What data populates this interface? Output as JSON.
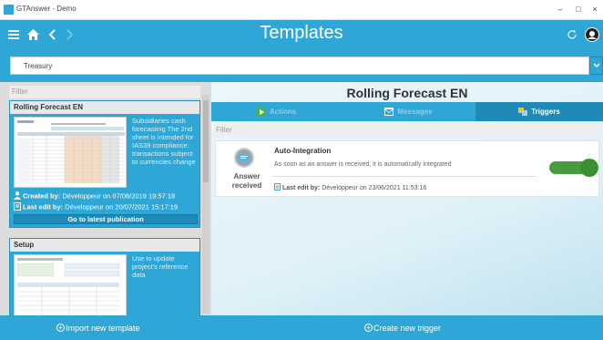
{
  "window": {
    "title": "GTAnswer - Demo",
    "minimize": "–",
    "maximize": "□",
    "close": "×"
  },
  "header": {
    "title": "Templates"
  },
  "selector": {
    "value": "Treasury"
  },
  "left": {
    "filter_placeholder": "Filter",
    "templates": [
      {
        "name": "Rolling Forecast EN",
        "description": "Subsidiaries cash forecasting The 2nd sheet is intended for IAS39 compliance: transactions subject to currencies change",
        "created_label": "Created by:",
        "created_value": "Développeur on 07/06/2019 19:57:18",
        "edit_label": "Last edit by:",
        "edit_value": "Développeur on 20/07/2021 15:17:19",
        "action": "Go to latest publication"
      },
      {
        "name": "Setup",
        "description": "Use to update project's reference data"
      }
    ]
  },
  "detail": {
    "title": "Rolling Forecast EN",
    "tabs": [
      {
        "label": "Actions",
        "icon": "play-icon"
      },
      {
        "label": "Messages",
        "icon": "message-icon"
      },
      {
        "label": "Triggers",
        "icon": "triggers-icon"
      }
    ],
    "filter_placeholder": "Filter",
    "trigger": {
      "event": "Answer received",
      "name": "Auto-Integration",
      "description": "As soon as an answer is received, it is automatically integrated",
      "edit_label": "Last edit by:",
      "edit_value": "Développeur on 23/06/2021 11:53:16",
      "enabled": true
    }
  },
  "footer": {
    "import": "Import new template",
    "create": "Create new trigger"
  },
  "colors": {
    "accent": "#2ea6d6",
    "accent_dark": "#1f8ab7",
    "toggle_on": "#4a9a3f"
  }
}
